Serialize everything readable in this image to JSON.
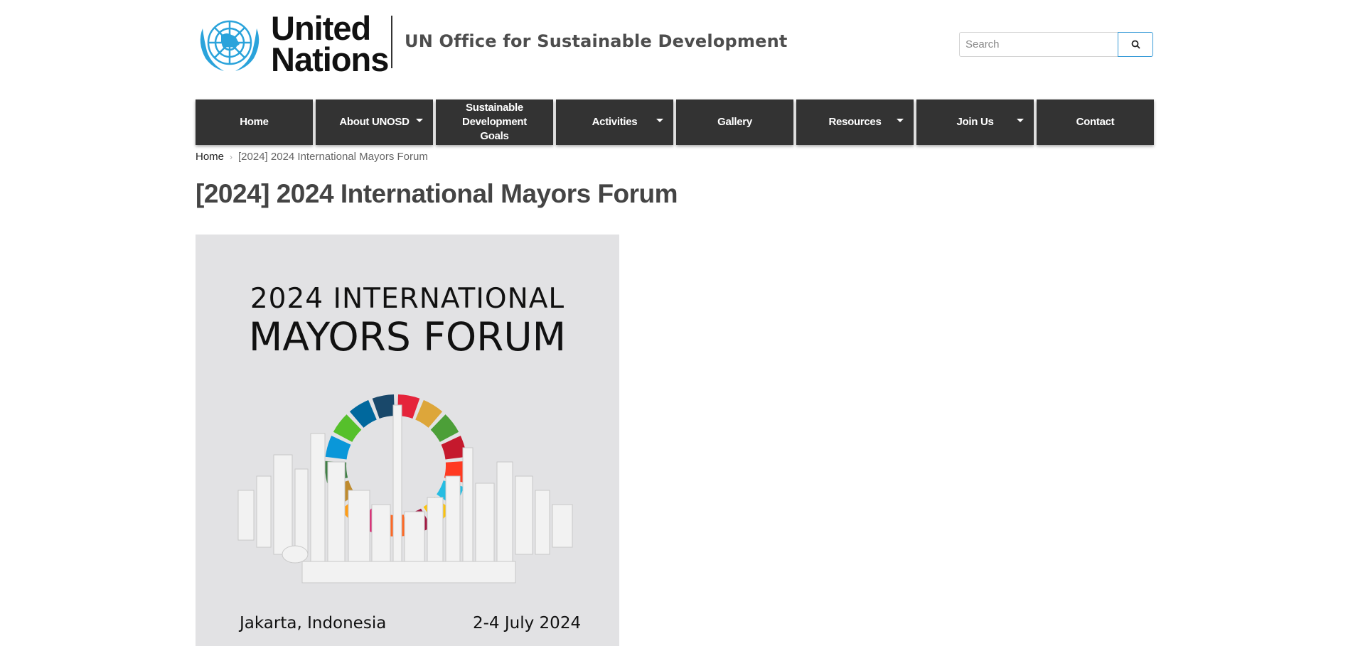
{
  "header": {
    "org_line1": "United",
    "org_line2": "Nations",
    "site_name": "UN Office for Sustainable Development",
    "search": {
      "placeholder": "Search",
      "value": ""
    }
  },
  "nav": {
    "items": [
      {
        "label": "Home",
        "dropdown": false
      },
      {
        "label": "About UNOSD",
        "dropdown": true
      },
      {
        "label": "Sustainable Development Goals",
        "dropdown": false
      },
      {
        "label": "Activities",
        "dropdown": true
      },
      {
        "label": "Gallery",
        "dropdown": false
      },
      {
        "label": "Resources",
        "dropdown": true
      },
      {
        "label": "Join Us",
        "dropdown": true
      },
      {
        "label": "Contact",
        "dropdown": false
      }
    ]
  },
  "breadcrumb": {
    "home": "Home",
    "separator": "›",
    "current": "[2024] 2024 International Mayors Forum"
  },
  "page": {
    "title": "[2024] 2024 International Mayors Forum"
  },
  "poster": {
    "line1": "2024 INTERNATIONAL",
    "line2": "MAYORS FORUM",
    "place": "Jakarta, Indonesia",
    "date": "2-4 July 2024",
    "background_color": "#e2e2e4",
    "sdg_colors": [
      "#e5243b",
      "#dda63a",
      "#4c9f38",
      "#c5192d",
      "#ff3a21",
      "#26bde2",
      "#fcc30b",
      "#a21942",
      "#fd6925",
      "#dd1367",
      "#ff9d15",
      "#bf8b2e",
      "#3f7e44",
      "#0a97d9",
      "#56c02b",
      "#00689d",
      "#19486a"
    ]
  },
  "colors": {
    "nav_bg": "#333333",
    "accent": "#3a9cd8",
    "un_blue": "#2aa3db"
  },
  "icons": {
    "emblem": "un-emblem-icon",
    "search": "search-icon",
    "caret": "caret-down-icon"
  }
}
